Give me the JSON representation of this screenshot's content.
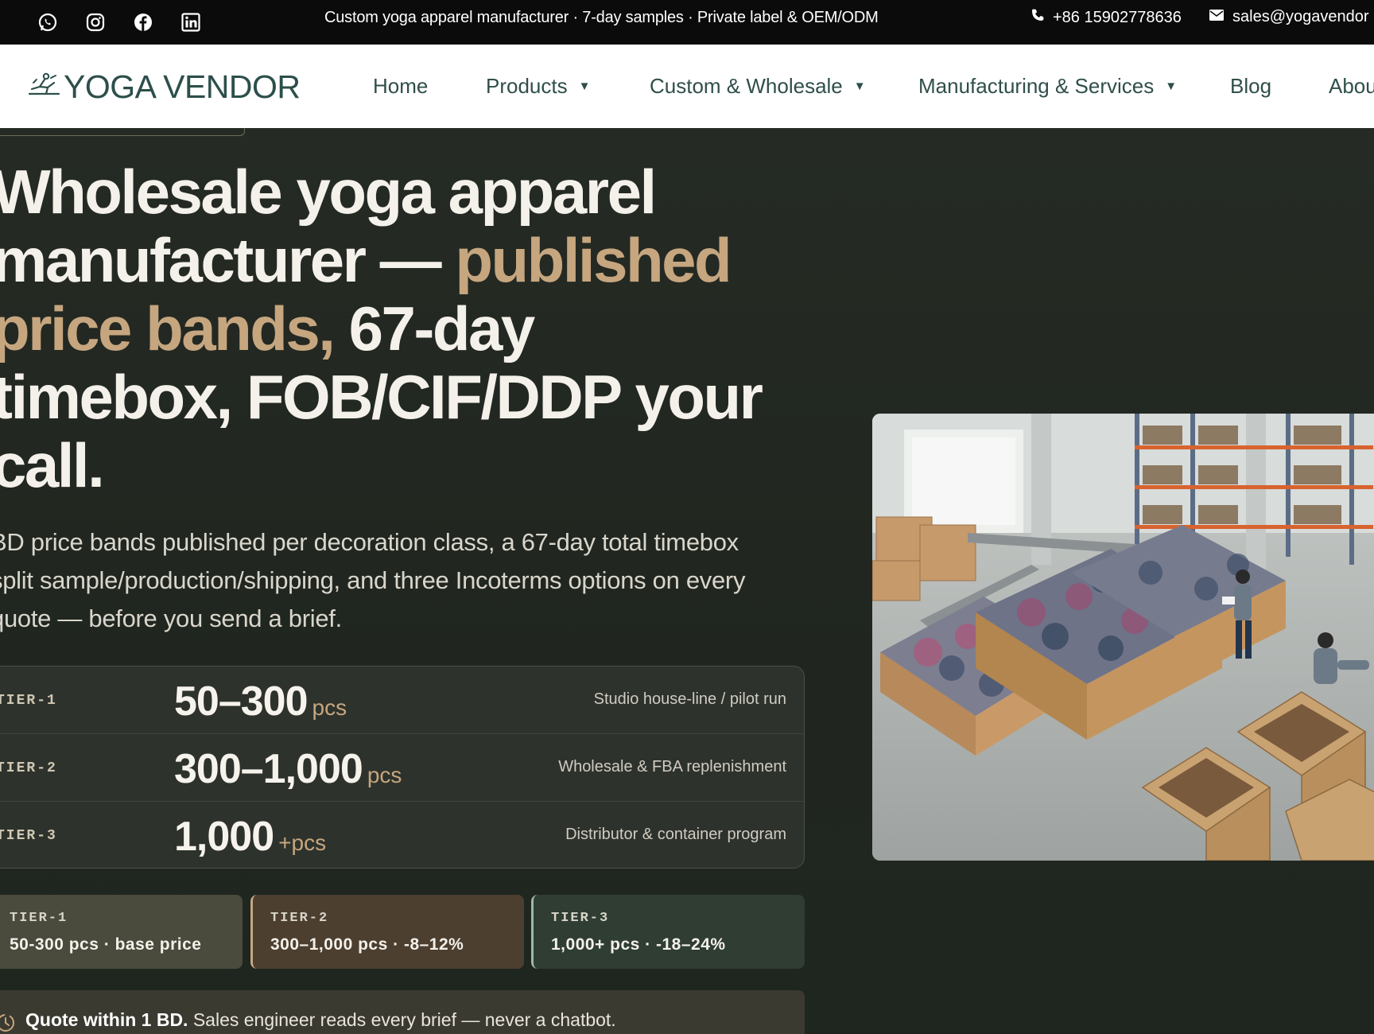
{
  "topbar": {
    "tagline": "Custom yoga apparel manufacturer · 7-day samples · Private label & OEM/ODM",
    "phone": "+86 15902778636",
    "email": "sales@yogavendor",
    "social_icons": [
      "whatsapp-icon",
      "instagram-icon",
      "facebook-icon",
      "linkedin-icon"
    ]
  },
  "nav": {
    "logo_text": "YOGA VENDOR",
    "items": [
      {
        "label": "Home"
      },
      {
        "label": "Products"
      },
      {
        "label": "Custom & Wholesale"
      },
      {
        "label": "Manufacturing & Services"
      },
      {
        "label": "Blog"
      },
      {
        "label": "Abou"
      }
    ]
  },
  "hero": {
    "headline_a": "Wholesale yoga apparel manufacturer — ",
    "headline_accent": "published price bands,",
    "headline_b": " 67-day timebox, FOB/CIF/DDP your call.",
    "subtext": "BD price bands published per decoration class, a 67-day total timebox split sample/production/shipping, and three Incoterms options on every quote — before you send a brief."
  },
  "tiers": [
    {
      "label": "TIER-1",
      "range": "50–300",
      "unit": "pcs",
      "desc": "Studio house-line / pilot run"
    },
    {
      "label": "TIER-2",
      "range": "300–1,000",
      "unit": "pcs",
      "desc": "Wholesale & FBA replenishment"
    },
    {
      "label": "TIER-3",
      "range": "1,000",
      "unit": "+pcs",
      "desc": "Distributor & container program"
    }
  ],
  "cards": [
    {
      "title": "TIER-1",
      "text": "50-300 pcs · base price"
    },
    {
      "title": "TIER-2",
      "text": "300–1,000 pcs · -8–12%"
    },
    {
      "title": "TIER-3",
      "text": "1,000+ pcs · -18–24%"
    }
  ],
  "quote": {
    "bold": "Quote within 1 BD.",
    "text": " Sales engineer reads every brief — never a chatbot."
  },
  "colors": {
    "accent": "#c6a67f",
    "brand": "#2c4f4b",
    "background": "#232822"
  }
}
